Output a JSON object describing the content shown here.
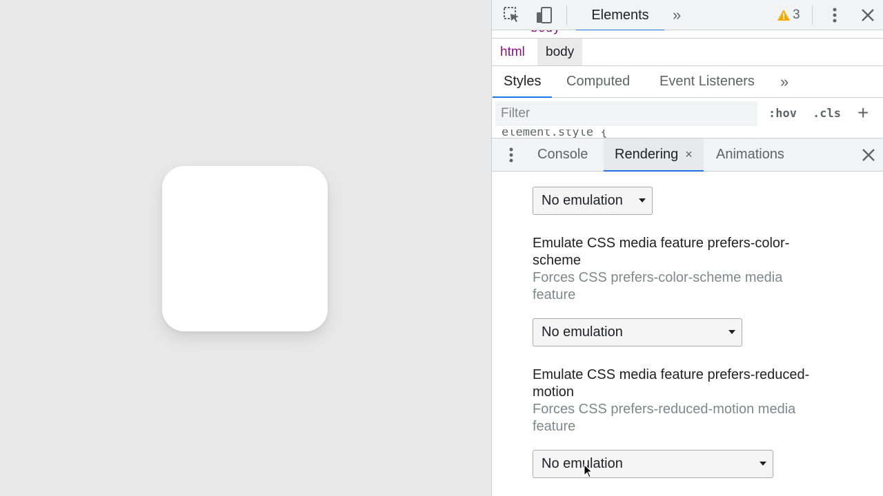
{
  "toolbar": {
    "inspect_icon": "inspect-element-icon",
    "device_icon": "device-toolbar-icon",
    "active_tab": "Elements",
    "more_tabs": "»",
    "warning_count": "3",
    "menu_icon": "kebab-menu-icon",
    "close_icon": "close-icon"
  },
  "dom_peek": "body",
  "breadcrumb": {
    "items": [
      "html",
      "body"
    ]
  },
  "styles_tabs": {
    "items": [
      "Styles",
      "Computed",
      "Event Listeners"
    ],
    "more": "»",
    "active": "Styles"
  },
  "filter": {
    "placeholder": "Filter",
    "hov": ":hov",
    "cls": ".cls",
    "plus": "+"
  },
  "rule_peek": "element.style {",
  "drawer": {
    "tabs": [
      "Console",
      "Rendering",
      "Animations"
    ],
    "active": "Rendering",
    "tab_close": "×",
    "close": "×"
  },
  "rendering": {
    "select1": "No emulation",
    "section2": {
      "title": "Emulate CSS media feature prefers-color-scheme",
      "desc": "Forces CSS prefers-color-scheme media feature",
      "select": "No emulation"
    },
    "section3": {
      "title": "Emulate CSS media feature prefers-reduced-motion",
      "desc": "Forces CSS prefers-reduced-motion media feature",
      "select": "No emulation"
    }
  },
  "colors": {
    "accent": "#1a73e8",
    "warning": "#f9ab00",
    "tag": "#881280"
  }
}
